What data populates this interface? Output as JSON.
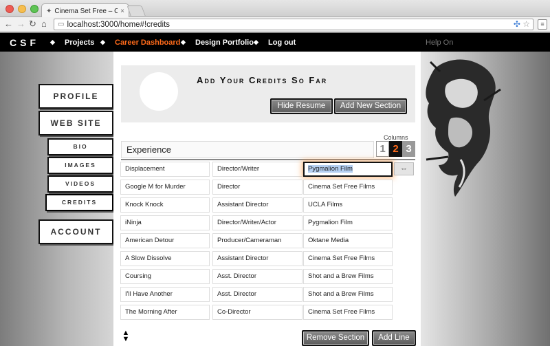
{
  "browser": {
    "tab_title": "Cinema Set Free – Career D",
    "tab_close": "×",
    "url": "localhost:3000/home#!credits",
    "back": "←",
    "forward": "→",
    "reload": "↻",
    "home": "⌂"
  },
  "site": {
    "logo": "CSF",
    "nav": [
      "Projects",
      "Career Dashboard",
      "Design Portfolio",
      "Log out"
    ],
    "separator": "◆",
    "help": "Help On"
  },
  "sidebar": {
    "profile": "Profile",
    "website": "Web Site",
    "bio": "Bio",
    "images": "Images",
    "videos": "Videos",
    "credits": "Credits",
    "account": "Account"
  },
  "header": {
    "title": "Add Your Credits So Far",
    "hide_resume": "Hide Resume",
    "add_section": "Add New Section"
  },
  "section": {
    "name": "Experience",
    "columns_label": "Columns",
    "column_options": [
      "1",
      "2",
      "3"
    ],
    "selected_columns": "2"
  },
  "credits": [
    [
      "Displacement",
      "Director/Writer",
      "Pygmalion Film"
    ],
    [
      "Google M for Murder",
      "Director",
      "Cinema Set Free Films"
    ],
    [
      "Knock Knock",
      "Assistant Director",
      "UCLA Films"
    ],
    [
      "iNinja",
      "Director/Writer/Actor",
      "Pygmalion Film"
    ],
    [
      "American Detour",
      "Producer/Cameraman",
      "Oktane Media"
    ],
    [
      "A Slow Dissolve",
      "Assistant Director",
      "Cinema Set Free Films"
    ],
    [
      "Coursing",
      "Asst. Director",
      "Shot and a Brew Films"
    ],
    [
      "I'll Have Another",
      "Asst. Director",
      "Shot and a Brew Films"
    ],
    [
      "The Morning After",
      "Co-Director",
      "Cinema Set Free Films"
    ]
  ],
  "footer": {
    "remove_section": "Remove Section",
    "add_line": "Add Line"
  },
  "colors": {
    "accent": "#ff6a1a",
    "nav_bg": "#000000"
  }
}
